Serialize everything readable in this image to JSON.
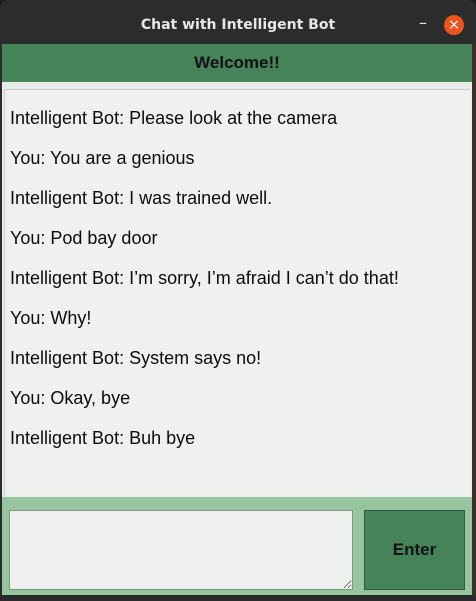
{
  "window": {
    "title": "Chat with Intelligent Bot",
    "minimize_symbol": "–",
    "close_symbol": "×"
  },
  "header": {
    "text": "Welcome!!"
  },
  "chat": {
    "messages": [
      "Intelligent Bot: Please look at the camera",
      "You: You are a genious",
      "Intelligent Bot: I was trained well.",
      "You: Pod bay door",
      "Intelligent Bot: I’m sorry, I’m afraid I can’t do that!",
      "You: Why!",
      "Intelligent Bot: System says no!",
      "You: Okay, bye",
      "Intelligent Bot: Buh bye"
    ]
  },
  "input": {
    "value": ""
  },
  "enter_button": {
    "label": "Enter"
  },
  "colors": {
    "header_bg": "#46835a",
    "bottom_bar_bg": "#96c59f",
    "close_button": "#e95420"
  }
}
